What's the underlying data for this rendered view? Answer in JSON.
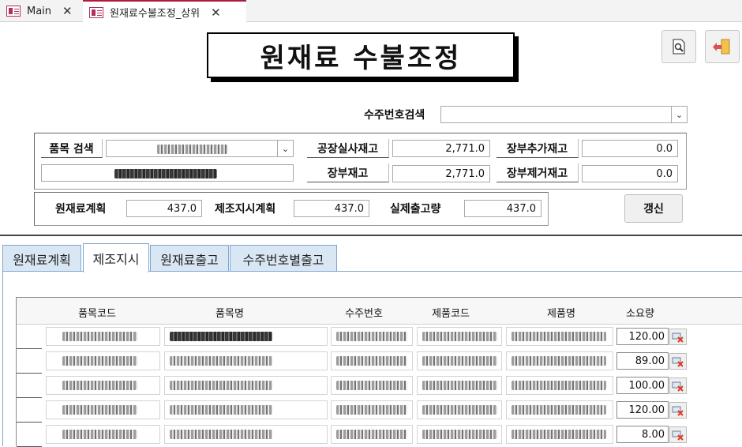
{
  "doc_tabs": [
    {
      "label": "Main"
    },
    {
      "label": "원재료수불조정_상위"
    }
  ],
  "header": {
    "title": "원재료 수불조정",
    "preview_icon": "print-preview-icon",
    "exit_icon": "exit-door-icon"
  },
  "search": {
    "order_search_label": "수주번호검색",
    "order_search_value": "",
    "item_search_label": "품목 검색"
  },
  "stock": {
    "factory_actual_label": "공장실사재고",
    "factory_actual_value": "2,771.0",
    "book_stock_label": "장부재고",
    "book_stock_value": "2,771.0",
    "book_add_label": "장부추가재고",
    "book_add_value": "0.0",
    "book_remove_label": "장부제거재고",
    "book_remove_value": "0.0"
  },
  "plan": {
    "material_plan_label": "원재료계획",
    "material_plan_value": "437.0",
    "work_order_plan_label": "제조지시계획",
    "work_order_plan_value": "437.0",
    "actual_out_label": "실제출고량",
    "actual_out_value": "437.0",
    "refresh_label": "갱신"
  },
  "tabs": [
    {
      "label": "원재료계획",
      "selected": false
    },
    {
      "label": "제조지시",
      "selected": true
    },
    {
      "label": "원재료출고",
      "selected": false
    },
    {
      "label": "수주번호별출고",
      "selected": false
    }
  ],
  "grid": {
    "columns": [
      "품목코드",
      "품목명",
      "수주번호",
      "제품코드",
      "제품명",
      "소요량"
    ],
    "rows": [
      {
        "qty": "120.00"
      },
      {
        "qty": "89.00"
      },
      {
        "qty": "100.00"
      },
      {
        "qty": "120.00"
      },
      {
        "qty": "8.00"
      }
    ]
  },
  "colors": {
    "accent": "#b01b3a",
    "tab_bg": "#d9e7f5",
    "tab_border": "#7ea6cf"
  }
}
